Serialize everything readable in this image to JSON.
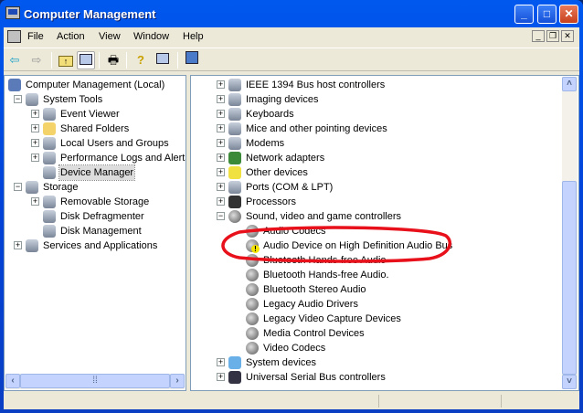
{
  "window": {
    "title": "Computer Management",
    "controls": [
      "minimize",
      "maximize",
      "close"
    ]
  },
  "menu": [
    "File",
    "Action",
    "View",
    "Window",
    "Help"
  ],
  "toolbar": [
    {
      "name": "back-button",
      "icon": "back-arrow-icon"
    },
    {
      "name": "forward-button",
      "icon": "forward-arrow-icon"
    },
    {
      "name": "up-one-level-button",
      "icon": "folder-up-icon"
    },
    {
      "name": "show-hide-console-tree-button",
      "icon": "console-tree-icon",
      "pressed": true
    },
    {
      "name": "print-button",
      "icon": "printer-icon"
    },
    {
      "name": "help-button",
      "icon": "help-icon"
    },
    {
      "name": "show-hide-action-pane-button",
      "icon": "action-pane-icon"
    },
    {
      "name": "properties-button",
      "icon": "properties-icon"
    }
  ],
  "left_tree": [
    {
      "label": "Computer Management (Local)",
      "level": 0,
      "exp": "",
      "icon": "computer"
    },
    {
      "label": "System Tools",
      "level": 1,
      "exp": "-",
      "icon": "tools"
    },
    {
      "label": "Event Viewer",
      "level": 2,
      "exp": "+",
      "icon": "event"
    },
    {
      "label": "Shared Folders",
      "level": 2,
      "exp": "+",
      "icon": "folder"
    },
    {
      "label": "Local Users and Groups",
      "level": 2,
      "exp": "+",
      "icon": "users"
    },
    {
      "label": "Performance Logs and Alerts",
      "level": 2,
      "exp": "+",
      "icon": "perf"
    },
    {
      "label": "Device Manager",
      "level": 2,
      "exp": "",
      "icon": "device",
      "selected": true
    },
    {
      "label": "Storage",
      "level": 1,
      "exp": "-",
      "icon": "storage"
    },
    {
      "label": "Removable Storage",
      "level": 2,
      "exp": "+",
      "icon": "removable"
    },
    {
      "label": "Disk Defragmenter",
      "level": 2,
      "exp": "",
      "icon": "defrag"
    },
    {
      "label": "Disk Management",
      "level": 2,
      "exp": "",
      "icon": "disk"
    },
    {
      "label": "Services and Applications",
      "level": 1,
      "exp": "+",
      "icon": "services"
    }
  ],
  "right_tree": [
    {
      "label": "IEEE 1394 Bus host controllers",
      "level": 0,
      "exp": "+",
      "icon": "ieee"
    },
    {
      "label": "Imaging devices",
      "level": 0,
      "exp": "+",
      "icon": "imaging"
    },
    {
      "label": "Keyboards",
      "level": 0,
      "exp": "+",
      "icon": "keyboard"
    },
    {
      "label": "Mice and other pointing devices",
      "level": 0,
      "exp": "+",
      "icon": "mouse"
    },
    {
      "label": "Modems",
      "level": 0,
      "exp": "+",
      "icon": "modem"
    },
    {
      "label": "Network adapters",
      "level": 0,
      "exp": "+",
      "icon": "network"
    },
    {
      "label": "Other devices",
      "level": 0,
      "exp": "+",
      "icon": "unknown"
    },
    {
      "label": "Ports (COM & LPT)",
      "level": 0,
      "exp": "+",
      "icon": "port"
    },
    {
      "label": "Processors",
      "level": 0,
      "exp": "+",
      "icon": "cpu"
    },
    {
      "label": "Sound, video and game controllers",
      "level": 0,
      "exp": "-",
      "icon": "speaker"
    },
    {
      "label": "Audio Codecs",
      "level": 1,
      "exp": "",
      "icon": "speaker"
    },
    {
      "label": "Audio Device on High Definition Audio Bus",
      "level": 1,
      "exp": "",
      "icon": "speaker",
      "warning": true,
      "circled": true
    },
    {
      "label": "Bluetooth Hands-free Audio",
      "level": 1,
      "exp": "",
      "icon": "speaker"
    },
    {
      "label": "Bluetooth Hands-free Audio.",
      "level": 1,
      "exp": "",
      "icon": "speaker"
    },
    {
      "label": "Bluetooth Stereo Audio",
      "level": 1,
      "exp": "",
      "icon": "speaker"
    },
    {
      "label": "Legacy Audio Drivers",
      "level": 1,
      "exp": "",
      "icon": "speaker"
    },
    {
      "label": "Legacy Video Capture Devices",
      "level": 1,
      "exp": "",
      "icon": "speaker"
    },
    {
      "label": "Media Control Devices",
      "level": 1,
      "exp": "",
      "icon": "speaker"
    },
    {
      "label": "Video Codecs",
      "level": 1,
      "exp": "",
      "icon": "speaker"
    },
    {
      "label": "System devices",
      "level": 0,
      "exp": "+",
      "icon": "system"
    },
    {
      "label": "Universal Serial Bus controllers",
      "level": 0,
      "exp": "+",
      "icon": "usb"
    }
  ],
  "right_scroll_position": 1.0,
  "colors": {
    "annotation": "#e8101a",
    "warning": "#f5e300",
    "titlebar": "#0058ee"
  }
}
